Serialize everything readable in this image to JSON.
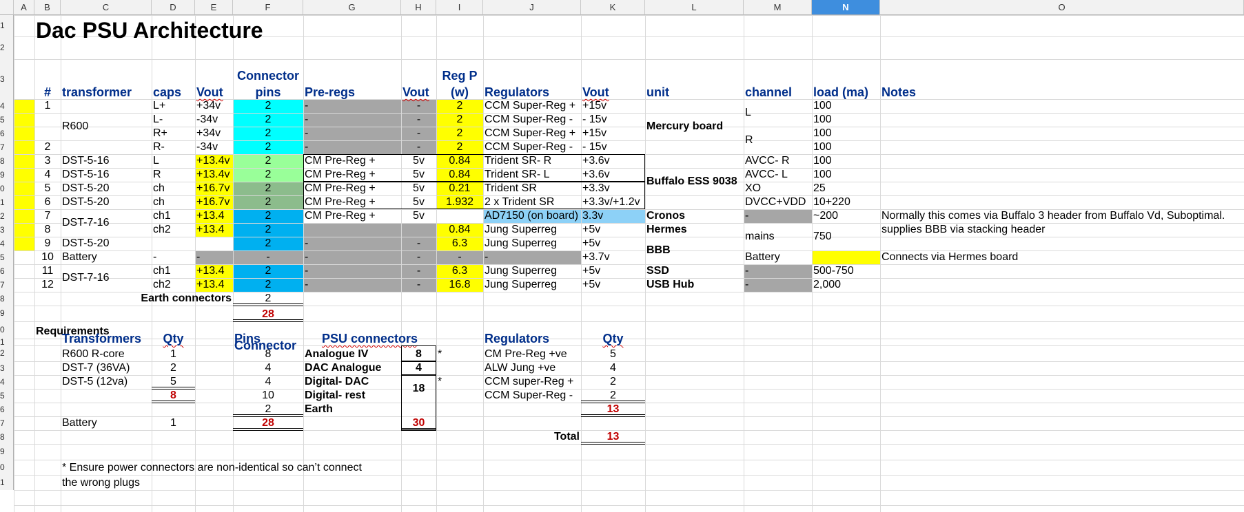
{
  "columns": [
    "A",
    "B",
    "C",
    "D",
    "E",
    "F",
    "G",
    "H",
    "I",
    "J",
    "K",
    "L",
    "M",
    "N",
    "O"
  ],
  "row_numbers": [
    "1",
    "2",
    "3",
    "4",
    "5",
    "6",
    "7",
    "8",
    "9",
    "0",
    "1",
    "2",
    "3",
    "4",
    "5",
    "6",
    "7",
    "8",
    "9",
    "0",
    "1",
    "2",
    "3",
    "4",
    "5",
    "6",
    "7",
    "8",
    "9",
    "0",
    "1"
  ],
  "title": "Dac PSU Architecture",
  "headers": {
    "num": "#",
    "transformer": "transformer",
    "caps": "caps",
    "vout1": "Vout",
    "connector_pins_1": "Connector",
    "connector_pins_2": "pins",
    "preregs": "Pre-regs",
    "vout2": "Vout",
    "regp_1": "Reg P",
    "regp_2": "(w)",
    "regulators": "Regulators",
    "vout3": "Vout",
    "unit": "unit",
    "channel": "channel",
    "load": "load (ma)",
    "notes": "Notes"
  },
  "rows": [
    {
      "num": "1",
      "caps": "L+",
      "vout": "+34v",
      "pins": "2",
      "prereg": "-",
      "vout2": "-",
      "regp": "2",
      "reg": "CCM Super-Reg +",
      "vout3": "+15v",
      "load": "100"
    },
    {
      "num": "",
      "caps": "L-",
      "vout": "-34v",
      "pins": "2",
      "prereg": "-",
      "vout2": "-",
      "regp": "2",
      "reg": "CCM Super-Reg -",
      "vout3": " - 15v",
      "load": "100"
    },
    {
      "num": "",
      "caps": "R+",
      "vout": "+34v",
      "pins": "2",
      "prereg": "-",
      "vout2": "-",
      "regp": "2",
      "reg": "CCM Super-Reg +",
      "vout3": "+15v",
      "load": "100"
    },
    {
      "num": "2",
      "caps": "R-",
      "vout": "-34v",
      "pins": "2",
      "prereg": "-",
      "vout2": "-",
      "regp": "2",
      "reg": "CCM Super-Reg -",
      "vout3": " - 15v",
      "load": "100"
    },
    {
      "num": "3",
      "transformer": "DST-5-16",
      "caps": "L",
      "vout": "+13.4v",
      "pins": "2",
      "prereg": "CM Pre-Reg +",
      "vout2": "5v",
      "regp": "0.84",
      "reg": "Trident SR- R",
      "vout3": "+3.6v",
      "channel": "AVCC- R",
      "load": "100"
    },
    {
      "num": "4",
      "transformer": "DST-5-16",
      "caps": "R",
      "vout": "+13.4v",
      "pins": "2",
      "prereg": "CM Pre-Reg +",
      "vout2": "5v",
      "regp": "0.84",
      "reg": "Trident SR- L",
      "vout3": "+3.6v",
      "channel": "AVCC- L",
      "load": "100"
    },
    {
      "num": "5",
      "transformer": "DST-5-20",
      "caps": "ch",
      "vout": "+16.7v",
      "pins": "2",
      "prereg": "CM Pre-Reg +",
      "vout2": "5v",
      "regp": "0.21",
      "reg": "Trident SR",
      "vout3": "+3.3v",
      "channel": "XO",
      "load": "25"
    },
    {
      "num": "6",
      "transformer": "DST-5-20",
      "caps": "ch",
      "vout": "+16.7v",
      "pins": "2",
      "prereg": "CM Pre-Reg +",
      "vout2": "5v",
      "regp": "1.932",
      "reg": "2 x Trident SR",
      "vout3": "+3.3v/+1.2v",
      "channel": "DVCC+VDD",
      "load": "10+220"
    },
    {
      "num": "7",
      "caps": "ch1",
      "vout": "+13.4",
      "pins": "2",
      "prereg": "CM Pre-Reg +",
      "vout2": "5v",
      "regp": "",
      "reg": "AD7150 (on board)",
      "vout3": "3.3v",
      "unit": "Cronos",
      "channel": "-",
      "load": "~200",
      "notes": "Normally this comes via Buffalo 3 header from Buffalo Vd, Suboptimal."
    },
    {
      "num": "8",
      "caps": "ch2",
      "vout": "+13.4",
      "pins": "2",
      "prereg": "",
      "vout2": "",
      "regp": "0.84",
      "reg": "Jung Superreg",
      "vout3": "+5v",
      "unit": "Hermes",
      "notes": "supplies BBB via stacking header"
    },
    {
      "num": "9",
      "transformer": "DST-5-20",
      "caps": "",
      "vout": "",
      "pins": "2",
      "prereg": "-",
      "vout2": "-",
      "regp": "6.3",
      "reg": "Jung Superreg",
      "vout3": "+5v"
    },
    {
      "num": "10",
      "transformer": "Battery",
      "caps": "-",
      "vout": "-",
      "pins": "-",
      "prereg": "-",
      "vout2": "-",
      "regp": "-",
      "reg": "-",
      "vout3": "+3.7v",
      "channel": "Battery",
      "notes": "Connects via Hermes board"
    },
    {
      "num": "11",
      "caps": "ch1",
      "vout": "+13.4",
      "pins": "2",
      "prereg": "-",
      "vout2": "-",
      "regp": "6.3",
      "reg": "Jung Superreg",
      "vout3": "+5v",
      "unit": "SSD",
      "channel": "-",
      "load": "500-750"
    },
    {
      "num": "12",
      "caps": "ch2",
      "vout": "+13.4",
      "pins": "2",
      "prereg": "-",
      "vout2": "-",
      "regp": "16.8",
      "reg": "Jung Superreg",
      "vout3": "+5v",
      "unit": "USB Hub",
      "channel": "-",
      "load": "2,000"
    }
  ],
  "merged": {
    "r600": "R600",
    "dst716a": "DST-7-16",
    "dst716b": "DST-7-16",
    "mercury": "Mercury board",
    "buffalo": "Buffalo ESS 9038",
    "bbb": "BBB",
    "ch_l": "L",
    "ch_r": "R",
    "mains": "mains",
    "load_mains": "750"
  },
  "earth_label": "Earth connectors",
  "earth_value": "2",
  "pins_total": "28",
  "requirements": {
    "title": "Requirements",
    "transformers_header": "Transformers",
    "qty_header": "Qty",
    "pins_header_1": "Connector",
    "pins_header_2": "Pins",
    "psu_header": "PSU connectors",
    "regulators_header": "Regulators",
    "reg_qty_header": "Qty",
    "transformers": [
      {
        "name": "R600 R-core",
        "qty": "1"
      },
      {
        "name": "DST-7 (36VA)",
        "qty": "2"
      },
      {
        "name": "DST-5 (12va)",
        "qty": "5"
      }
    ],
    "transformer_total": "8",
    "battery": {
      "name": "Battery",
      "qty": "1"
    },
    "pins": [
      "8",
      "4",
      "4",
      "10",
      "2"
    ],
    "pins_total": "28",
    "psu": [
      {
        "name": "Analogue IV",
        "qty": "8",
        "star": "*"
      },
      {
        "name": "DAC Analogue",
        "qty": "4",
        "star": ""
      },
      {
        "name": "Digital- DAC",
        "qty": "",
        "star": "*"
      },
      {
        "name": "Digital- rest",
        "qty": "18",
        "star": ""
      },
      {
        "name": "Earth",
        "qty": "",
        "star": ""
      }
    ],
    "psu_total": "30",
    "regulators": [
      {
        "name": "CM Pre-Reg +ve",
        "qty": "5"
      },
      {
        "name": "ALW Jung +ve",
        "qty": "4"
      },
      {
        "name": "CCM super-Reg +",
        "qty": "2"
      },
      {
        "name": "CCM Super-Reg -",
        "qty": "2"
      }
    ],
    "reg_total": "13",
    "total_label": "Total",
    "total_value": "13"
  },
  "footnote_1": "* Ensure power connectors are non-identical so can’t connect",
  "footnote_2": "the  wrong plugs",
  "colors": {
    "yellow": "#ffff00",
    "cyan": "#00ffff",
    "gray": "#a6a6a6",
    "lightgreen": "#99ff99",
    "darkgreen": "#8cbc8c",
    "blue": "#00b0f0",
    "lightblue": "#8dd1f7",
    "header_blue": "#002e8a",
    "red": "#c00000"
  }
}
